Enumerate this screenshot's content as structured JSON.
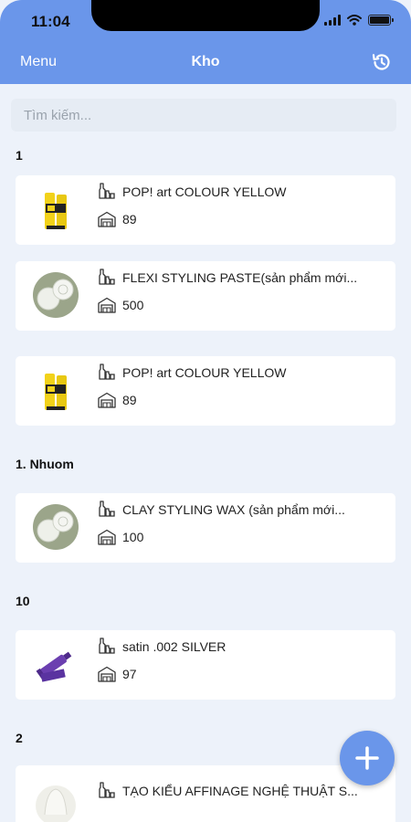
{
  "status": {
    "time": "11:04"
  },
  "nav": {
    "menu_label": "Menu",
    "title": "Kho"
  },
  "search": {
    "placeholder": "Tìm kiếm..."
  },
  "sections": [
    {
      "title": "1",
      "items": [
        {
          "name": "POP! art COLOUR YELLOW",
          "qty": "89",
          "thumb": "yellow-tube"
        },
        {
          "name": "FLEXI STYLING PASTE(sản phẩm mới...",
          "qty": "500",
          "thumb": "wax-jars"
        },
        {
          "name": "POP! art COLOUR YELLOW",
          "qty": "89",
          "thumb": "yellow-tube"
        }
      ]
    },
    {
      "title": "1. Nhuom",
      "items": [
        {
          "name": "CLAY STYLING WAX (sản phẩm mới...",
          "qty": "100",
          "thumb": "wax-jars"
        }
      ]
    },
    {
      "title": "10",
      "items": [
        {
          "name": "satin .002 SILVER",
          "qty": "97",
          "thumb": "purple-tube"
        }
      ]
    },
    {
      "title": "2",
      "items": [
        {
          "name": "TẠO KIỂU AFFINAGE  NGHỆ THUẬT S...",
          "qty": "",
          "thumb": "white-product"
        }
      ]
    }
  ],
  "colors": {
    "accent": "#6a96ea",
    "background": "#edf2fa"
  }
}
